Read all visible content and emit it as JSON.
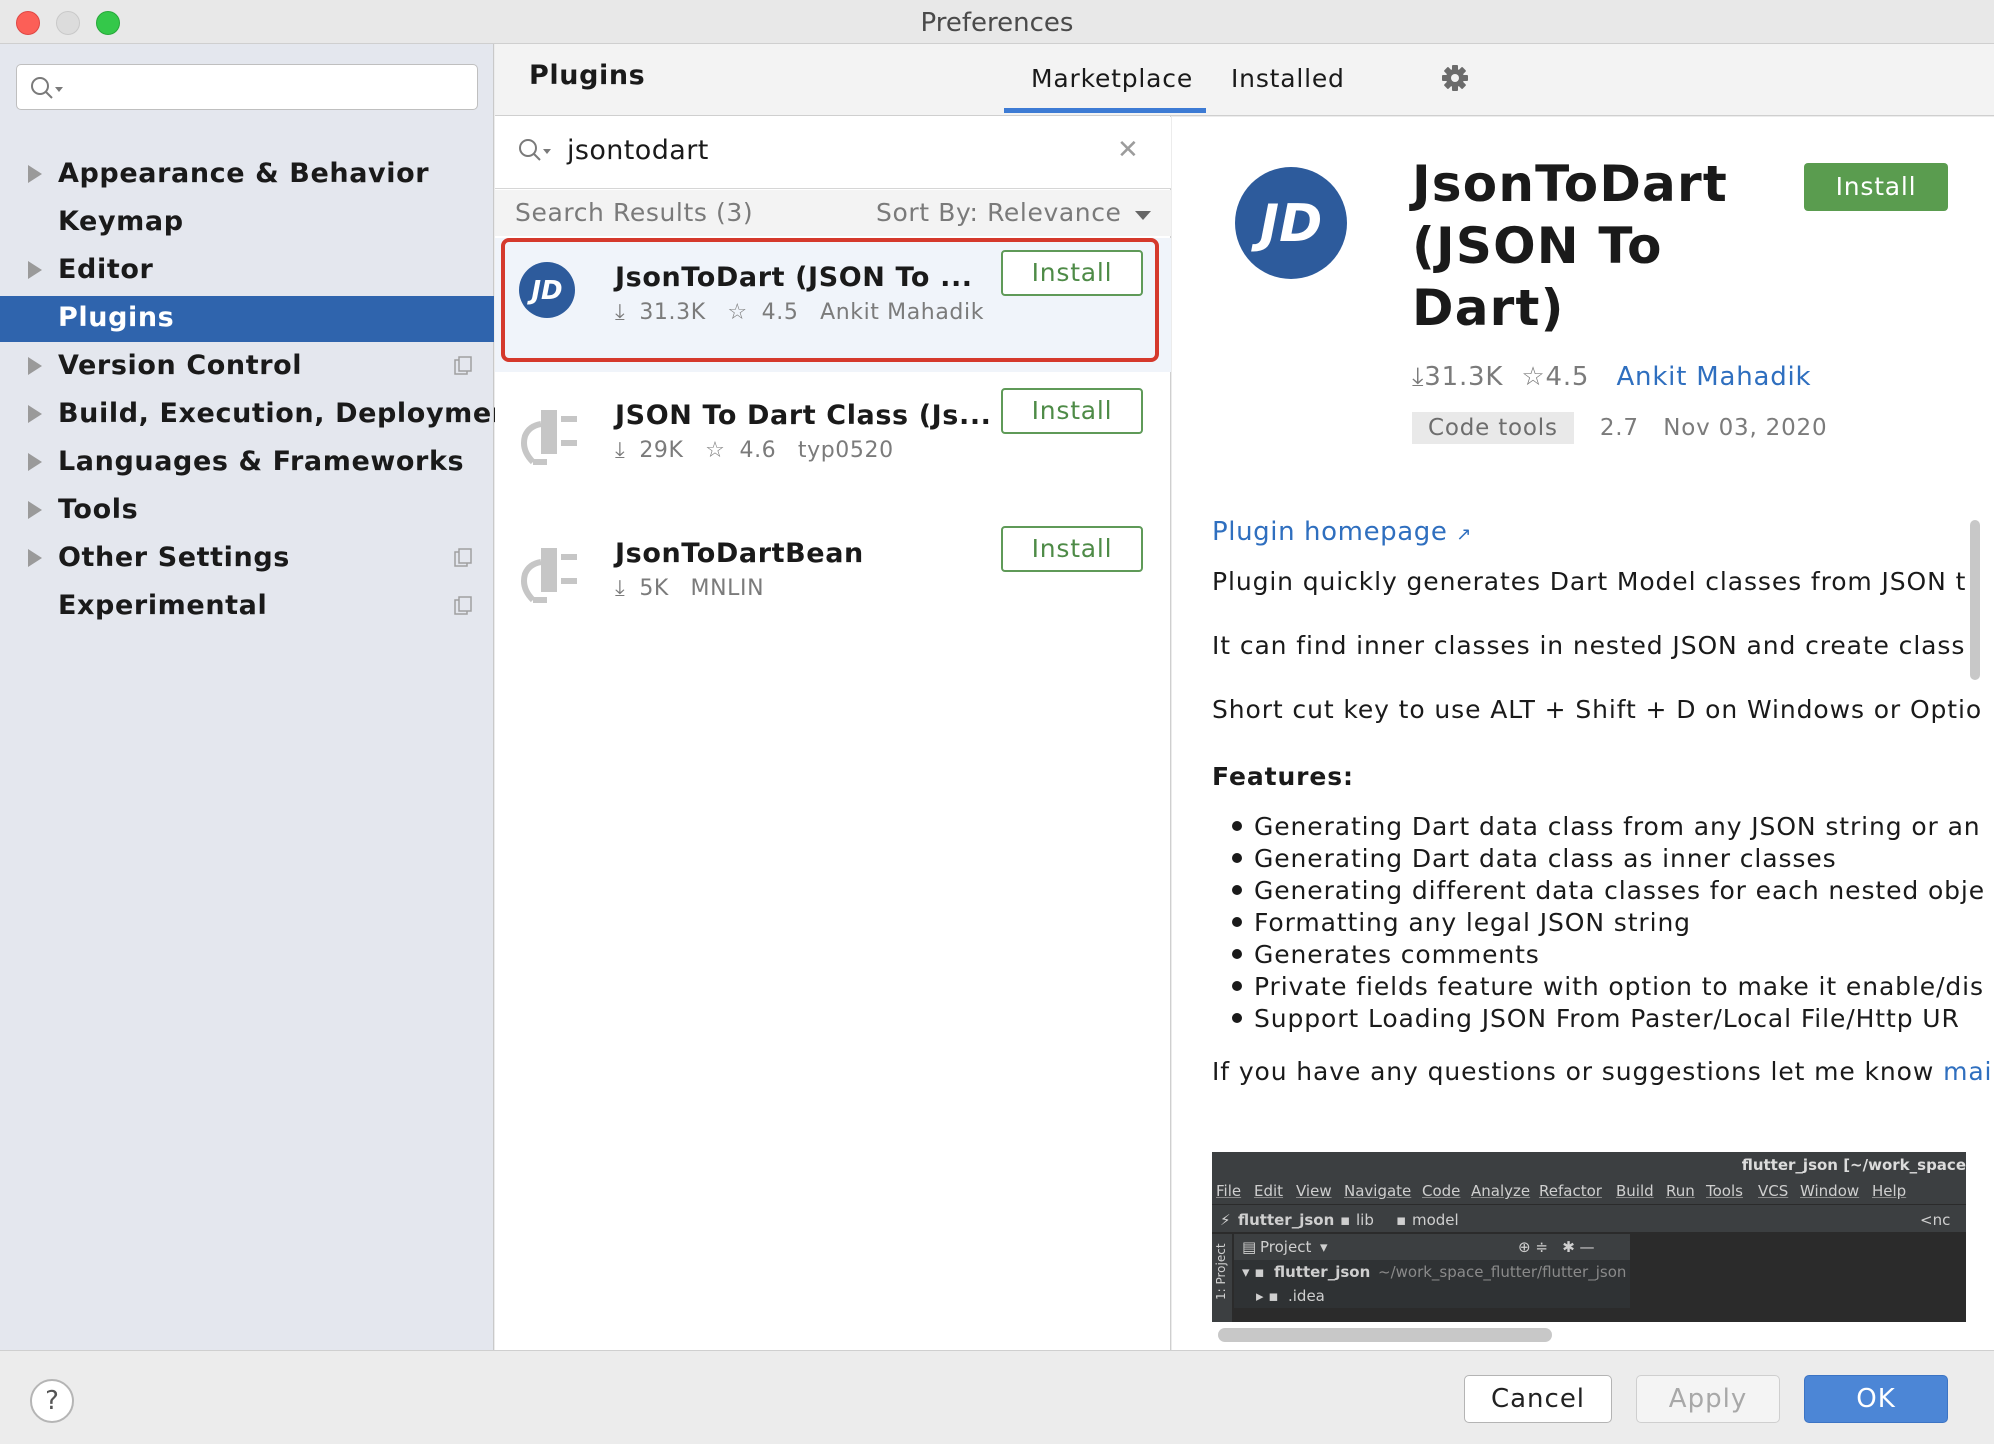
{
  "window": {
    "title": "Preferences"
  },
  "sidebar": {
    "search_placeholder": "",
    "items": [
      {
        "label": "Appearance & Behavior",
        "expandable": true
      },
      {
        "label": "Keymap",
        "expandable": false
      },
      {
        "label": "Editor",
        "expandable": true
      },
      {
        "label": "Plugins",
        "expandable": false,
        "selected": true
      },
      {
        "label": "Version Control",
        "expandable": true
      },
      {
        "label": "Build, Execution, Deployment",
        "expandable": true
      },
      {
        "label": "Languages & Frameworks",
        "expandable": true
      },
      {
        "label": "Tools",
        "expandable": true
      },
      {
        "label": "Other Settings",
        "expandable": true
      },
      {
        "label": "Experimental",
        "expandable": false
      }
    ]
  },
  "header": {
    "title": "Plugins",
    "tabs": [
      "Marketplace",
      "Installed"
    ],
    "active_tab": "Marketplace"
  },
  "search": {
    "value": "jsontodart"
  },
  "results": {
    "count_label": "Search Results (3)",
    "sort_label": "Sort By: Relevance",
    "plugins": [
      {
        "name": "JsonToDart (JSON To ...",
        "downloads": "31.3K",
        "rating": "4.5",
        "author": "Ankit Mahadik",
        "button": "Install"
      },
      {
        "name": "JSON To Dart Class (Js...",
        "downloads": "29K",
        "rating": "4.6",
        "author": "typ0520",
        "button": "Install"
      },
      {
        "name": "JsonToDartBean",
        "downloads": "5K",
        "rating": "",
        "author": "MNLIN",
        "button": "Install"
      }
    ]
  },
  "detail": {
    "logo_text": "JD",
    "title_lines": [
      "JsonToDart",
      "(JSON To",
      "Dart)"
    ],
    "install_label": "Install",
    "downloads": "31.3K",
    "rating": "4.5",
    "author": "Ankit Mahadik",
    "tag": "Code tools",
    "version": "2.7",
    "date": "Nov 03, 2020",
    "homepage_label": "Plugin homepage",
    "paragraphs": [
      "Plugin quickly generates Dart Model classes from JSON t",
      "It can find inner classes in nested JSON and create class",
      "Short cut key to use ALT + Shift + D on Windows or Optio"
    ],
    "features_heading": "Features:",
    "features": [
      "Generating Dart data class from any JSON string or an",
      "Generating Dart data class as inner classes",
      "Generating different data classes for each nested obje",
      "Formatting any legal JSON string",
      "Generates comments",
      "Private fields feature with option to make it enable/dis",
      "Support Loading JSON From Paster/Local File/Http UR"
    ],
    "closing_text": "If you have any questions or suggestions let me know",
    "closing_link": "mai",
    "screenshot": {
      "title": "flutter_json [~/work_space",
      "menu": [
        "File",
        "Edit",
        "View",
        "Navigate",
        "Code",
        "Analyze",
        "Refactor",
        "Build",
        "Run",
        "Tools",
        "VCS",
        "Window",
        "Help"
      ],
      "path": [
        "flutter_json",
        "lib",
        "model"
      ],
      "path_right": "<nc",
      "project_label": "Project",
      "side_label": "1: Project",
      "tree": [
        {
          "name": "flutter_json",
          "path": "~/work_space_flutter/flutter_json"
        },
        {
          "name": ".idea",
          "path": ""
        }
      ]
    }
  },
  "footer": {
    "help": "?",
    "cancel": "Cancel",
    "apply": "Apply",
    "ok": "OK"
  },
  "colors": {
    "accent": "#2f64ad",
    "install_green": "#5a9c4f",
    "link_blue": "#2f6fbf",
    "highlight_red": "#d5392c",
    "ok_blue": "#4c86d6"
  }
}
